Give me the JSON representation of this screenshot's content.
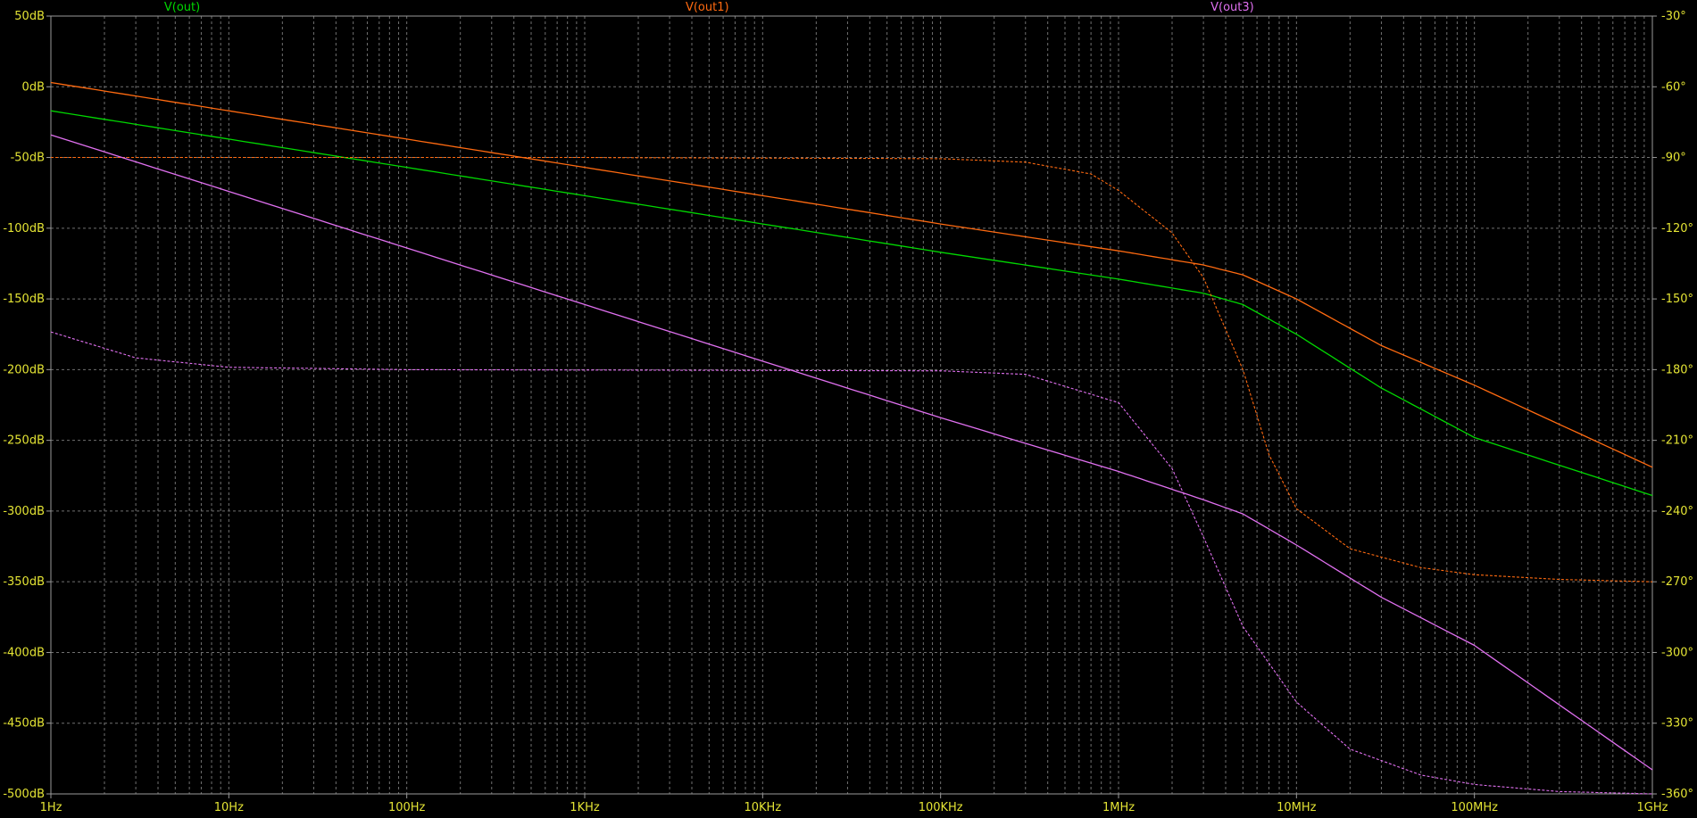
{
  "chart_data": {
    "type": "line",
    "x_scale": "log",
    "xlim": [
      1,
      1000000000
    ],
    "x_tick_values": [
      1,
      10,
      100,
      1000,
      10000,
      100000,
      1000000,
      10000000,
      100000000,
      1000000000
    ],
    "x_tick_labels": [
      "1Hz",
      "10Hz",
      "100Hz",
      "1KHz",
      "10KHz",
      "100KHz",
      "1MHz",
      "10MHz",
      "100MHz",
      "1GHz"
    ],
    "ylim_left": [
      -500,
      50
    ],
    "y_left_tick_values": [
      50,
      0,
      -50,
      -100,
      -150,
      -200,
      -250,
      -300,
      -350,
      -400,
      -450,
      -500
    ],
    "y_left_tick_labels": [
      "50dB",
      "0dB",
      "-50dB",
      "-100dB",
      "-150dB",
      "-200dB",
      "-250dB",
      "-300dB",
      "-350dB",
      "-400dB",
      "-450dB",
      "-500dB"
    ],
    "ylim_right": [
      -360,
      -30
    ],
    "y_right_tick_values": [
      -30,
      -60,
      -90,
      -120,
      -150,
      -180,
      -210,
      -240,
      -270,
      -300,
      -330,
      -360
    ],
    "y_right_tick_labels": [
      "-30°",
      "-60°",
      "-90°",
      "-120°",
      "-150°",
      "-180°",
      "-210°",
      "-240°",
      "-270°",
      "-300°",
      "-330°",
      "-360°"
    ],
    "grid": true,
    "background": "#000000",
    "grid_color": "#707070",
    "axis_text_color": "#e3e334",
    "series": [
      {
        "name": "V(out)",
        "color": "#00d800",
        "magnitude_db": [
          [
            1,
            -17
          ],
          [
            10,
            -37
          ],
          [
            100,
            -57
          ],
          [
            1000,
            -77
          ],
          [
            10000,
            -97
          ],
          [
            100000,
            -117
          ],
          [
            1000000,
            -136
          ],
          [
            3000000,
            -146
          ],
          [
            5000000,
            -154
          ],
          [
            10000000,
            -175
          ],
          [
            30000000,
            -213
          ],
          [
            100000000,
            -248
          ],
          [
            1000000000,
            -289
          ]
        ],
        "phase_deg": []
      },
      {
        "name": "V(out1)",
        "color": "#ff6a10",
        "magnitude_db": [
          [
            1,
            3
          ],
          [
            10,
            -17
          ],
          [
            100,
            -37
          ],
          [
            1000,
            -57
          ],
          [
            10000,
            -77
          ],
          [
            100000,
            -97
          ],
          [
            1000000,
            -116
          ],
          [
            3000000,
            -126
          ],
          [
            5000000,
            -133
          ],
          [
            10000000,
            -150
          ],
          [
            30000000,
            -183
          ],
          [
            100000000,
            -211
          ],
          [
            1000000000,
            -269
          ]
        ],
        "phase_deg": [
          [
            1,
            -90
          ],
          [
            1000,
            -90
          ],
          [
            100000,
            -90.5
          ],
          [
            300000,
            -92
          ],
          [
            700000,
            -97
          ],
          [
            1000000,
            -104
          ],
          [
            2000000,
            -122
          ],
          [
            3000000,
            -141
          ],
          [
            5000000,
            -180
          ],
          [
            7000000,
            -216
          ],
          [
            10000000,
            -239
          ],
          [
            20000000,
            -256
          ],
          [
            50000000,
            -264
          ],
          [
            100000000,
            -267
          ],
          [
            300000000,
            -269
          ],
          [
            1000000000,
            -270
          ]
        ]
      },
      {
        "name": "V(out3)",
        "color": "#e070f0",
        "magnitude_db": [
          [
            1,
            -34
          ],
          [
            10,
            -74
          ],
          [
            100,
            -114
          ],
          [
            1000,
            -154
          ],
          [
            10000,
            -194
          ],
          [
            100000,
            -234
          ],
          [
            1000000,
            -272
          ],
          [
            3000000,
            -292
          ],
          [
            5000000,
            -302
          ],
          [
            10000000,
            -324
          ],
          [
            30000000,
            -361
          ],
          [
            100000000,
            -395
          ],
          [
            1000000000,
            -483
          ]
        ],
        "phase_deg": [
          [
            1,
            -164
          ],
          [
            3,
            -175
          ],
          [
            10,
            -179
          ],
          [
            100,
            -180
          ],
          [
            100000,
            -180.5
          ],
          [
            300000,
            -182
          ],
          [
            1000000,
            -194
          ],
          [
            2000000,
            -222
          ],
          [
            3000000,
            -251
          ],
          [
            5000000,
            -289
          ],
          [
            10000000,
            -321
          ],
          [
            20000000,
            -341
          ],
          [
            50000000,
            -352
          ],
          [
            100000000,
            -356
          ],
          [
            300000000,
            -359
          ],
          [
            1000000000,
            -360
          ]
        ]
      }
    ]
  }
}
